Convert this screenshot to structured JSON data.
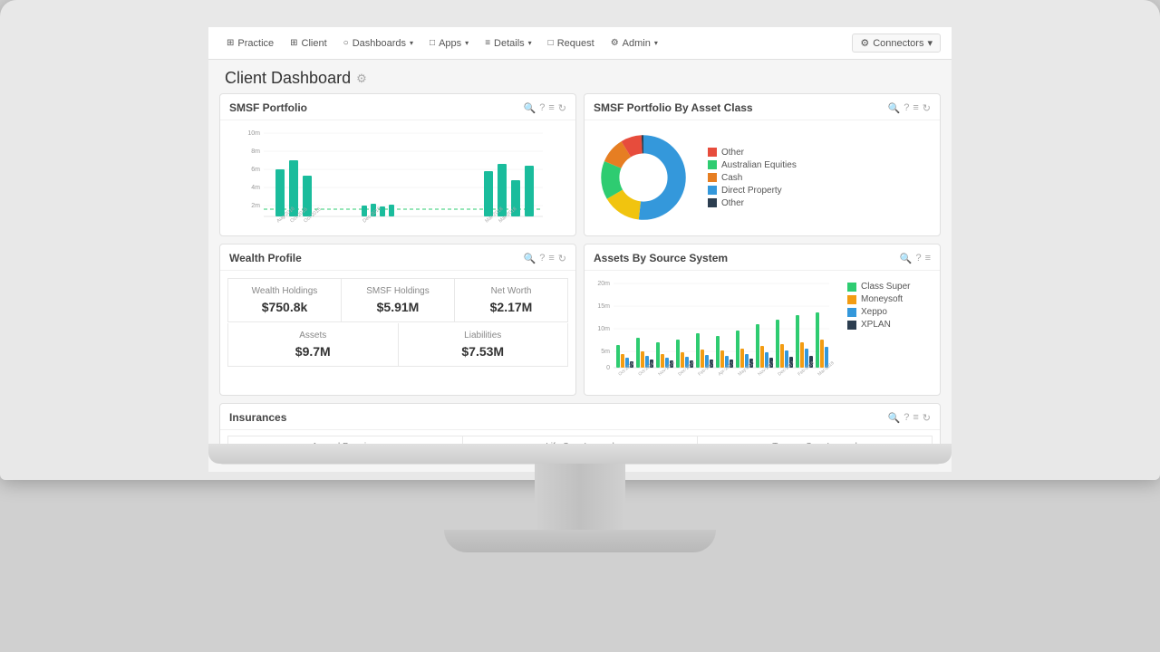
{
  "monitor": {
    "visible": true
  },
  "navbar": {
    "items": [
      {
        "label": "Practice",
        "icon": "⊞",
        "hasDropdown": false
      },
      {
        "label": "Client",
        "icon": "⊞",
        "hasDropdown": false
      },
      {
        "label": "Dashboards",
        "icon": "○",
        "hasDropdown": true
      },
      {
        "label": "Apps",
        "icon": "□",
        "hasDropdown": true
      },
      {
        "label": "Details",
        "icon": "≡",
        "hasDropdown": true
      },
      {
        "label": "Request",
        "icon": "□",
        "hasDropdown": false
      },
      {
        "label": "Admin",
        "icon": "⚙",
        "hasDropdown": true
      }
    ],
    "connectors_label": "Connectors",
    "connectors_caret": "▾"
  },
  "page": {
    "title": "Client Dashboard",
    "title_icon": "⚙"
  },
  "widgets": {
    "smsf_portfolio": {
      "title": "SMSF Portfolio",
      "y_labels": [
        "10m",
        "8m",
        "6m",
        "4m",
        "2m"
      ],
      "x_labels": [
        "Aug-2016",
        "Oct-2016",
        "Oct-2016",
        "Nov-2016",
        "Dec-2016",
        "Feb-2017",
        "Apr-2017",
        "May-2017",
        "Nov-2017",
        "Dec-2017",
        "Feb-2018",
        "Mar-2018",
        "Mar-2018"
      ]
    },
    "smsf_asset_class": {
      "title": "SMSF Portfolio By Asset Class",
      "legend": [
        {
          "label": "Other",
          "color": "#e74c3c"
        },
        {
          "label": "Australian Equities",
          "color": "#2ecc71"
        },
        {
          "label": "Cash",
          "color": "#e67e22"
        },
        {
          "label": "Direct Property",
          "color": "#3498db"
        },
        {
          "label": "Other",
          "color": "#2c3e50"
        }
      ],
      "donut": {
        "segments": [
          {
            "value": 8,
            "color": "#e74c3c"
          },
          {
            "value": 15,
            "color": "#2ecc71"
          },
          {
            "value": 10,
            "color": "#e67e22"
          },
          {
            "value": 52,
            "color": "#3498db"
          },
          {
            "value": 15,
            "color": "#f1c40f"
          }
        ]
      }
    },
    "wealth_profile": {
      "title": "Wealth Profile",
      "cells": [
        {
          "label": "Wealth Holdings",
          "value": "$750.8k"
        },
        {
          "label": "SMSF Holdings",
          "value": "$5.91M"
        },
        {
          "label": "Net Worth",
          "value": "$2.17M"
        }
      ],
      "cells2": [
        {
          "label": "Assets",
          "value": "$9.7M"
        },
        {
          "label": "Liabilities",
          "value": "$7.53M"
        }
      ]
    },
    "assets_source": {
      "title": "Assets By Source System",
      "legend": [
        {
          "label": "Class Super",
          "color": "#2ecc71"
        },
        {
          "label": "Moneysoft",
          "color": "#f39c12"
        },
        {
          "label": "Xeppo",
          "color": "#3498db"
        },
        {
          "label": "XPLAN",
          "color": "#2c3e50"
        }
      ],
      "x_labels": [
        "Oct-2016",
        "Oct-2016",
        "Nov-2016",
        "Dec-2016",
        "Feb-2017",
        "Apr-2017",
        "May-2017",
        "Nov-2017",
        "Dec-2017",
        "Feb-2018",
        "Mar-2018",
        "Mar-2018"
      ],
      "y_labels": [
        "20m",
        "15m",
        "10m",
        "5m",
        "0"
      ]
    },
    "insurances": {
      "title": "Insurances",
      "columns": [
        "Annual Premium",
        "Life Sum Insured",
        "Trauma Sum Insured"
      ]
    }
  }
}
